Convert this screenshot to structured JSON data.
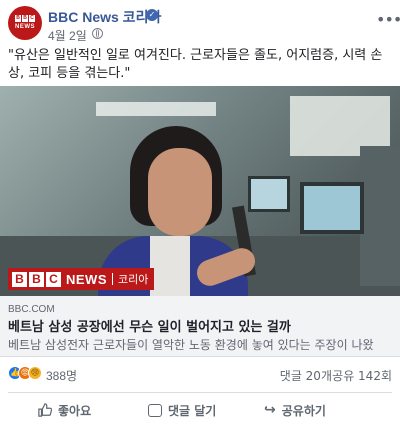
{
  "header": {
    "page_name": "BBC News 코리아",
    "date": "4월 2일",
    "dot": "·",
    "more_icon": "more-horizontal-icon",
    "verified_icon": "verified-badge-icon",
    "globe_icon": "public-globe-icon"
  },
  "avatar": {
    "bbc_letters": [
      "B",
      "B",
      "C"
    ],
    "news": "NEWS"
  },
  "post": {
    "text": "\"유산은 일반적인 일로 여겨진다. 근로자들은 졸도, 어지럼증, 시력 손상, 코피 등을 겪는다.\""
  },
  "media_logo": {
    "bbc_letters": [
      "B",
      "B",
      "C"
    ],
    "news": "NEWS",
    "korea": "코리아"
  },
  "link": {
    "domain": "BBC.COM",
    "title": "베트남 삼성 공장에선 무슨 일이 벌어지고 있는 걸까",
    "description": "베트남 삼성전자 근로자들이 열악한 노동 환경에 놓여 있다는 주장이 나왔"
  },
  "stats": {
    "reactions": [
      "like",
      "angry",
      "sad"
    ],
    "reaction_count": "388명",
    "comments": "댓글 20개",
    "shares": "공유 142회"
  },
  "actions": {
    "like": "좋아요",
    "comment": "댓글 달기",
    "share": "공유하기"
  },
  "colors": {
    "bbc_red": "#bb1919",
    "facebook_blue": "#385898",
    "like_blue": "#1877f2"
  }
}
